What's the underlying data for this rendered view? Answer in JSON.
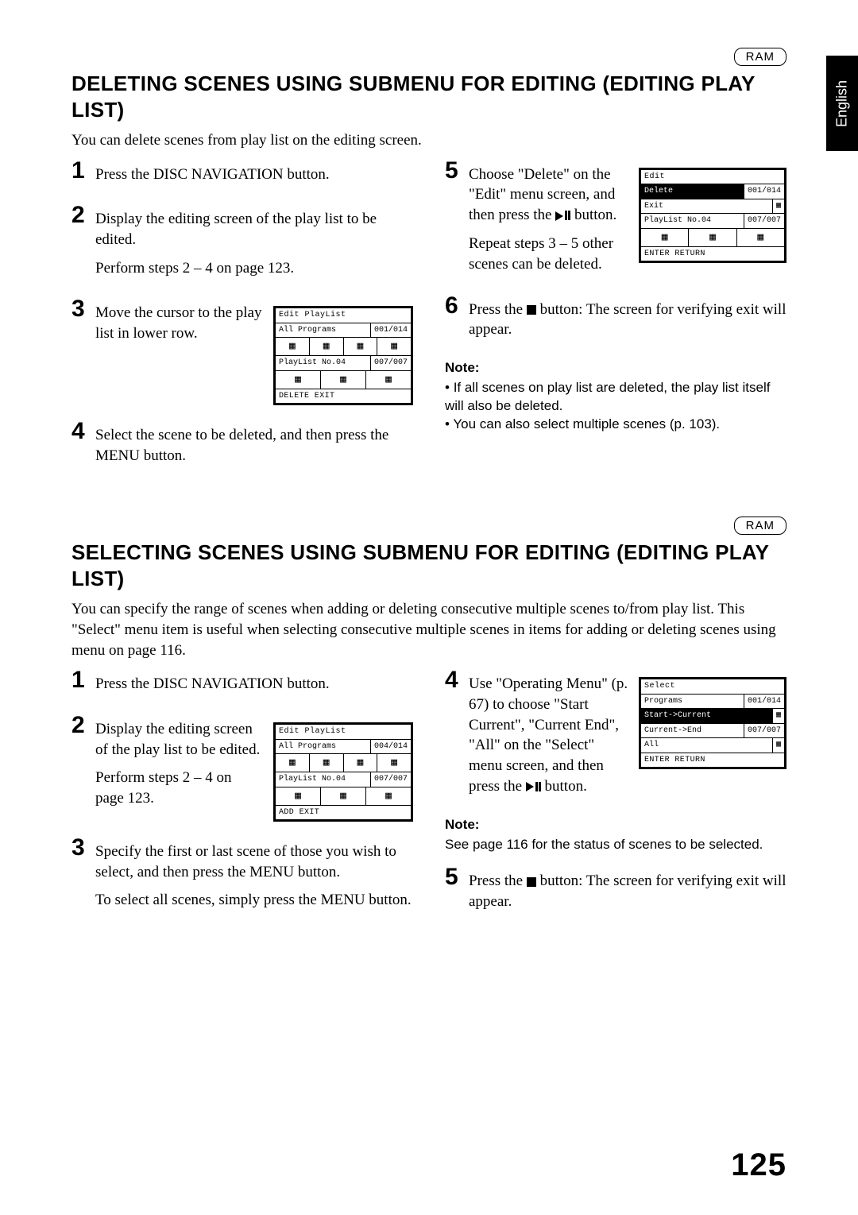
{
  "page": {
    "language_tab": "English",
    "page_number": "125"
  },
  "badges": {
    "ram": "RAM"
  },
  "section1": {
    "title": "DELETING SCENES USING SUBMENU FOR EDITING (EDITING PLAY LIST)",
    "intro": "You can delete scenes from play list on the editing screen.",
    "step1": "Press the DISC NAVIGATION button.",
    "step2": "Display the editing screen of the play list to be edited.",
    "step2_sub": "Perform steps 2 – 4 on page 123.",
    "step3": "Move the cursor to the play list in lower row.",
    "step4": "Select the scene to be deleted, and then press the MENU button.",
    "step5a": "Choose \"Delete\" on the \"Edit\" menu screen, and then press the ",
    "step5b": " button.",
    "step5_sub": "Repeat steps 3 – 5 other scenes can be deleted.",
    "step6a": "Press the ",
    "step6b": " button: The screen for verifying exit will appear.",
    "note_title": "Note:",
    "note_item1": "If all scenes on play list are deleted, the play list itself will also be deleted.",
    "note_item2": "You can also select multiple scenes (p. 103).",
    "diag1": {
      "title": "Edit PlayList",
      "row_programs_l": "All Programs",
      "row_programs_r": "001/014",
      "row_playlist_l": "PlayList No.04",
      "row_playlist_r": "007/007",
      "footer": "DELETE  EXIT"
    },
    "diag2": {
      "title": "Edit",
      "menu_delete": "Delete",
      "menu_exit": "Exit",
      "row_top_r": "001/014",
      "row_playlist_l": "PlayList No.04",
      "row_playlist_r": "007/007",
      "footer": "ENTER  RETURN"
    }
  },
  "section2": {
    "title": "SELECTING SCENES USING SUBMENU FOR EDITING (EDITING PLAY LIST)",
    "intro": "You can specify the range of scenes when adding or deleting consecutive multiple scenes to/from play list. This \"Select\" menu item is useful when selecting consecutive multiple scenes in items for adding or deleting scenes using menu on page 116.",
    "step1": "Press the DISC NAVIGATION button.",
    "step2": "Display the editing screen of the play list to be edited.",
    "step2_sub": "Perform steps 2 – 4 on page 123.",
    "step3": "Specify the first or last scene of those you wish to select, and then press the MENU button.",
    "step3_sub": "To select all scenes, simply press the MENU button.",
    "step4a": "Use \"Operating Menu\" (p. 67) to choose \"Start Current\", \"Current End\", \"All\" on the \"Select\" menu screen, and then press the ",
    "step4b": " button.",
    "note_title": "Note:",
    "note_body": "See page 116 for the status of scenes to be selected.",
    "step5a": "Press the ",
    "step5b": " button: The screen for verifying exit will appear.",
    "diag1": {
      "title": "Edit PlayList",
      "row_programs_l": "All Programs",
      "row_programs_r": "004/014",
      "row_playlist_l": "PlayList No.04",
      "row_playlist_r": "007/007",
      "footer": "ADD  EXIT"
    },
    "diag2": {
      "title": "Select",
      "row_programs_l": "Programs",
      "row_programs_r": "001/014",
      "menu_start": "Start->Current",
      "menu_end": "Current->End",
      "menu_all": "All",
      "row_pl_r": "007/007",
      "footer": "ENTER  RETURN"
    }
  }
}
